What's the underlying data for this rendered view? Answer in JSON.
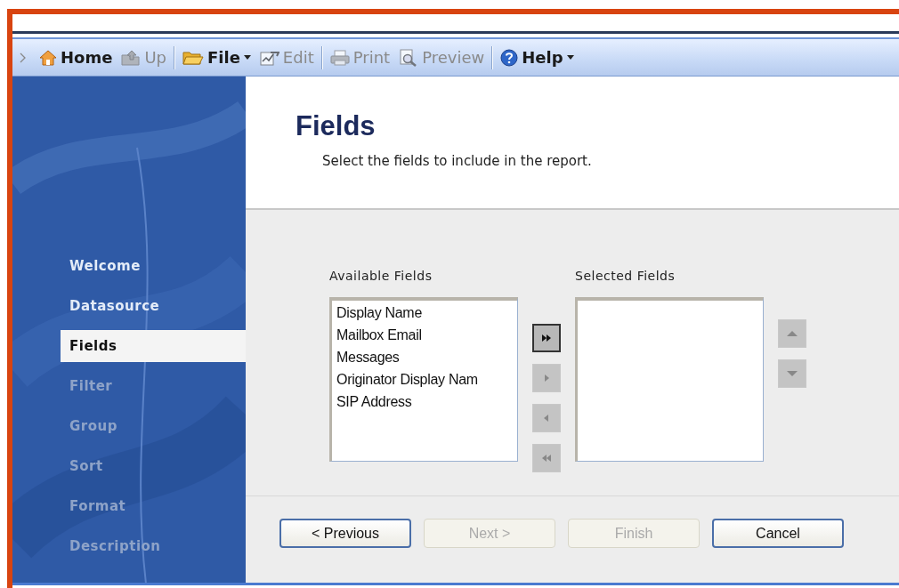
{
  "toolbar": {
    "items": [
      {
        "label": "Home",
        "kind": "home",
        "disabled": false,
        "dropdown": false
      },
      {
        "label": "Up",
        "kind": "up",
        "disabled": true,
        "dropdown": false
      },
      {
        "kind": "separator"
      },
      {
        "label": "File",
        "kind": "folder",
        "disabled": false,
        "dropdown": true
      },
      {
        "label": "Edit",
        "kind": "edit",
        "disabled": true,
        "dropdown": false
      },
      {
        "kind": "separator"
      },
      {
        "label": "Print",
        "kind": "print",
        "disabled": true,
        "dropdown": false
      },
      {
        "label": "Preview",
        "kind": "preview",
        "disabled": true,
        "dropdown": false
      },
      {
        "kind": "separator"
      },
      {
        "label": "Help",
        "kind": "help",
        "disabled": false,
        "dropdown": true
      }
    ]
  },
  "sidebar": {
    "items": [
      {
        "label": "Welcome",
        "selected": false,
        "disabled": false
      },
      {
        "label": "Datasource",
        "selected": false,
        "disabled": false
      },
      {
        "label": "Fields",
        "selected": true,
        "disabled": false
      },
      {
        "label": "Filter",
        "selected": false,
        "disabled": true
      },
      {
        "label": "Group",
        "selected": false,
        "disabled": true
      },
      {
        "label": "Sort",
        "selected": false,
        "disabled": true
      },
      {
        "label": "Format",
        "selected": false,
        "disabled": true
      },
      {
        "label": "Description",
        "selected": false,
        "disabled": true
      }
    ]
  },
  "header": {
    "title": "Fields",
    "subtitle": "Select the fields to include in the report."
  },
  "available_fields": {
    "label": "Available Fields",
    "items": [
      "Display Name",
      "Mailbox Email",
      "Messages",
      "Originator Display Nam",
      "SIP Address"
    ]
  },
  "move_buttons": [
    {
      "kind": "add_all",
      "disabled": false
    },
    {
      "kind": "add",
      "disabled": true
    },
    {
      "kind": "remove",
      "disabled": true
    },
    {
      "kind": "remove_all",
      "disabled": true
    }
  ],
  "selected_fields": {
    "label": "Selected Fields"
  },
  "order_buttons": [
    {
      "kind": "up",
      "disabled": true
    },
    {
      "kind": "down",
      "disabled": true
    }
  ],
  "buttons": [
    {
      "label": "< Previous",
      "disabled": false
    },
    {
      "label": "Next >",
      "disabled": true
    },
    {
      "label": "Finish",
      "disabled": true
    },
    {
      "label": "Cancel",
      "disabled": false
    }
  ]
}
